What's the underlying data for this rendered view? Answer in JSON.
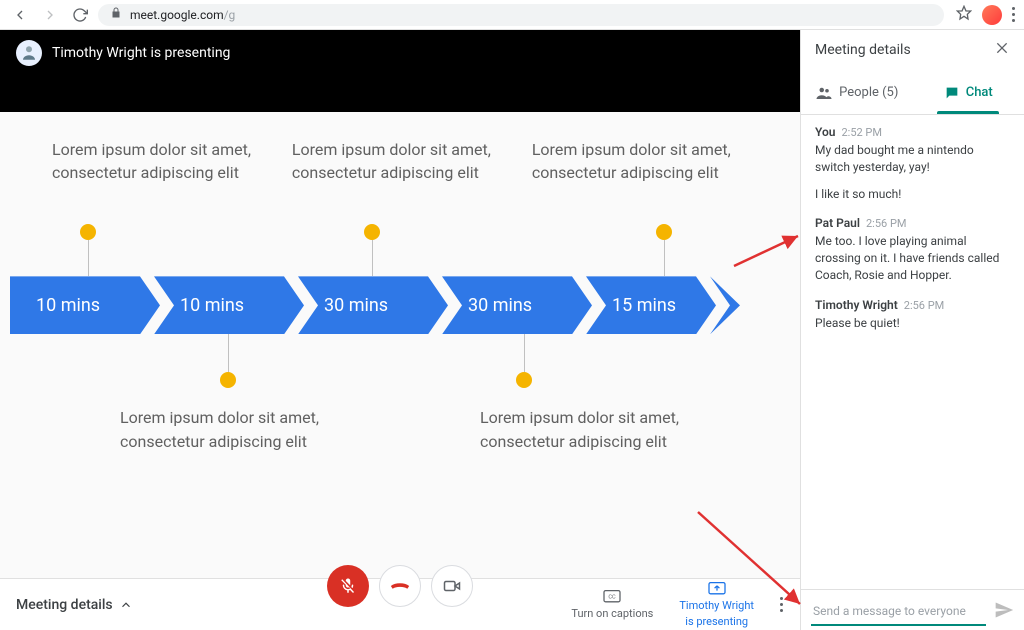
{
  "browser": {
    "url_host": "meet.google.com",
    "url_path": "/g"
  },
  "presenting": {
    "avatar_initial": "",
    "status": "Timothy Wright is presenting"
  },
  "slide": {
    "cells": {
      "1": "Lorem ipsum dolor sit amet, consectetur adipiscing elit",
      "2": "Lorem ipsum dolor sit amet, consectetur adipiscing elit",
      "3": "Lorem ipsum dolor sit amet, consectetur adipiscing elit",
      "4": "Lorem ipsum dolor sit amet, consectetur adipiscing elit",
      "5": "Lorem ipsum dolor sit amet, consectetur adipiscing elit"
    },
    "segments": {
      "1": "10 mins",
      "2": "10 mins",
      "3": "30 mins",
      "4": "30 mins",
      "5": "15 mins"
    }
  },
  "controls": {
    "meeting_details": "Meeting details",
    "captions": "Turn on captions",
    "presenting_name": "Timothy Wright",
    "presenting_sub": "is presenting"
  },
  "panel": {
    "title": "Meeting details",
    "tabs": {
      "people": "People (5)",
      "chat": "Chat"
    },
    "compose_placeholder": "Send a message to everyone"
  },
  "messages": [
    {
      "sender": "You",
      "time": "2:52 PM",
      "body": "My dad bought me a nintendo switch yesterday, yay!",
      "body2": "I like it so much!"
    },
    {
      "sender": "Pat Paul",
      "time": "2:56 PM",
      "body": "Me too. I love playing animal crossing on it. I have friends called Coach, Rosie and Hopper."
    },
    {
      "sender": "Timothy Wright",
      "time": "2:56 PM",
      "body": "Please be quiet!"
    }
  ]
}
